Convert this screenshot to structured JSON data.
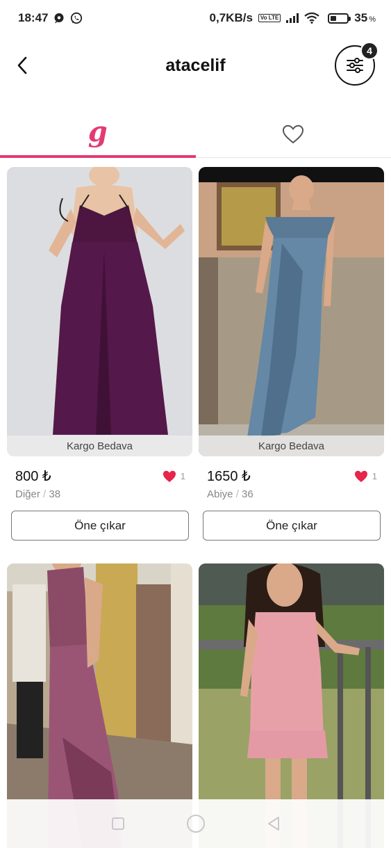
{
  "status_bar": {
    "time": "18:47",
    "network_speed": "0,7KB/s",
    "volte": "Vo LTE",
    "battery_percent": "35",
    "battery_unit": "%",
    "battery_level": 0.35,
    "icons": [
      "chat-bubble-icon",
      "whatsapp-icon",
      "signal-icon",
      "wifi-icon",
      "battery-icon"
    ]
  },
  "header": {
    "title": "atacelif",
    "filter_badge": "4",
    "icons": [
      "back-chevron-icon",
      "filter-sliders-icon"
    ]
  },
  "tabs": [
    {
      "id": "listings",
      "logo_text": "g",
      "active": true
    },
    {
      "id": "favorites",
      "icon": "heart-outline-icon",
      "active": false
    }
  ],
  "accent_color": "#e43a74",
  "like_color": "#e8254a",
  "products": [
    {
      "price": "800 ₺",
      "category": "Diğer",
      "size": "38",
      "likes": "1",
      "shipping": "Kargo Bedava",
      "promote_label": "Öne çıkar",
      "image": "purple-gown-photo"
    },
    {
      "price": "1650 ₺",
      "category": "Abiye",
      "size": "36",
      "likes": "1",
      "shipping": "Kargo Bedava",
      "promote_label": "Öne çıkar",
      "image": "blue-satin-gown-photo"
    },
    {
      "image": "mauve-one-shoulder-gown-photo"
    },
    {
      "image": "pink-dress-photo"
    }
  ],
  "nav_bar": {
    "icons": [
      "recents-square-icon",
      "home-circle-icon",
      "back-triangle-icon"
    ]
  }
}
